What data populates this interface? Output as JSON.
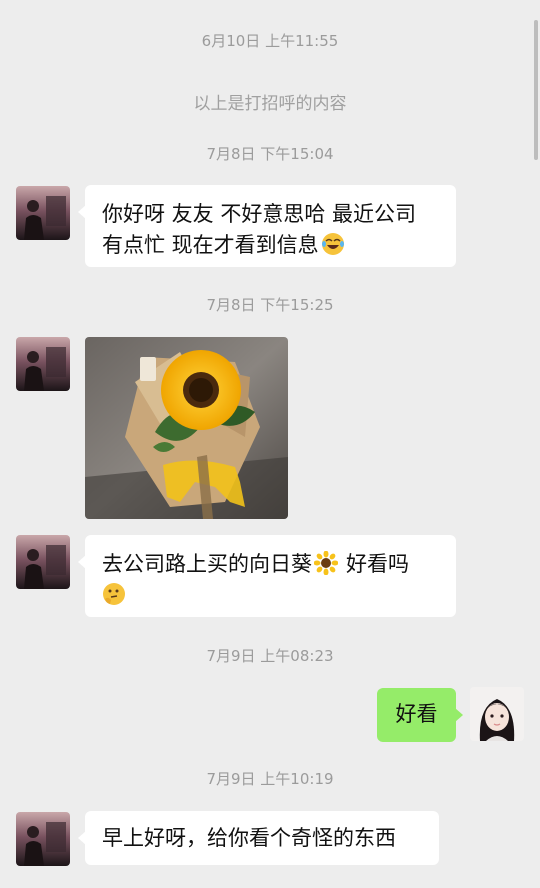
{
  "messages": {
    "ts1": "6月10日 上午11:55",
    "system_note": "以上是打招呼的内容",
    "ts2": "7月8日 下午15:04",
    "msg1_line1": "你好呀 友友 不好意思哈 最近公司",
    "msg1_line2": "有点忙 现在才看到信息",
    "ts3": "7月8日 下午15:25",
    "ts4_msg_line1": "去公司路上买的向日葵",
    "ts4_msg_line1_tail": "好看吗",
    "ts5": "7月9日 上午08:23",
    "reply": "好看",
    "ts6": "7月9日 上午10:19",
    "msg_last": "早上好呀，给你看个奇怪的东西"
  },
  "icons": {
    "laugh": "tears-of-joy-emoji",
    "sunflower": "sunflower-emoji",
    "think": "thinking-emoji"
  },
  "colors": {
    "background": "#ededed",
    "bubble_left": "#ffffff",
    "bubble_right": "#95ec69",
    "timestamp": "#9b9b9b"
  }
}
